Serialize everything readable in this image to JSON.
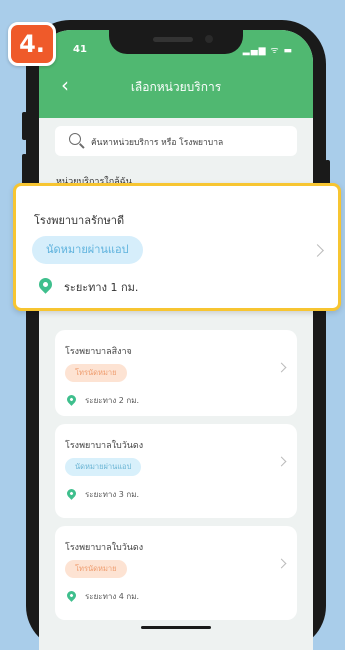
{
  "step_badge": "4.",
  "status_bar": {
    "time": "41",
    "icons": "▂▄▆ ᯤ ▬"
  },
  "header": {
    "title": "เลือกหน่วยบริการ",
    "back_icon": "chevron-left-icon"
  },
  "search": {
    "placeholder": "ค้นหาหน่วยบริการ หรือ โรงพยาบาล"
  },
  "section_label": "หน่วยบริการใกล้ฉัน",
  "highlighted_card": {
    "name": "โรงพยาบาลรักษาดี",
    "badge": "นัดหมายผ่านแอป",
    "distance": "ระยะทาง 1 กม."
  },
  "cards": [
    {
      "name": "โรงพยาบาลสิงาจ",
      "badge": "โทรนัดหมาย",
      "badge_color": "peach",
      "distance": "ระยะทาง 2 กม."
    },
    {
      "name": "โรงพยาบาลใบวันดง",
      "badge": "นัดหมายผ่านแอป",
      "badge_color": "blue",
      "distance": "ระยะทาง 3 กม."
    },
    {
      "name": "โรงพยาบาลใบวันดง",
      "badge": "โทรนัดหมาย",
      "badge_color": "peach",
      "distance": "ระยะทาง 4 กม."
    }
  ],
  "colors": {
    "appbar": "#50b871",
    "highlight_border": "#f7c531",
    "step_badge": "#ef5a2a",
    "pin": "#3fbf8d"
  }
}
